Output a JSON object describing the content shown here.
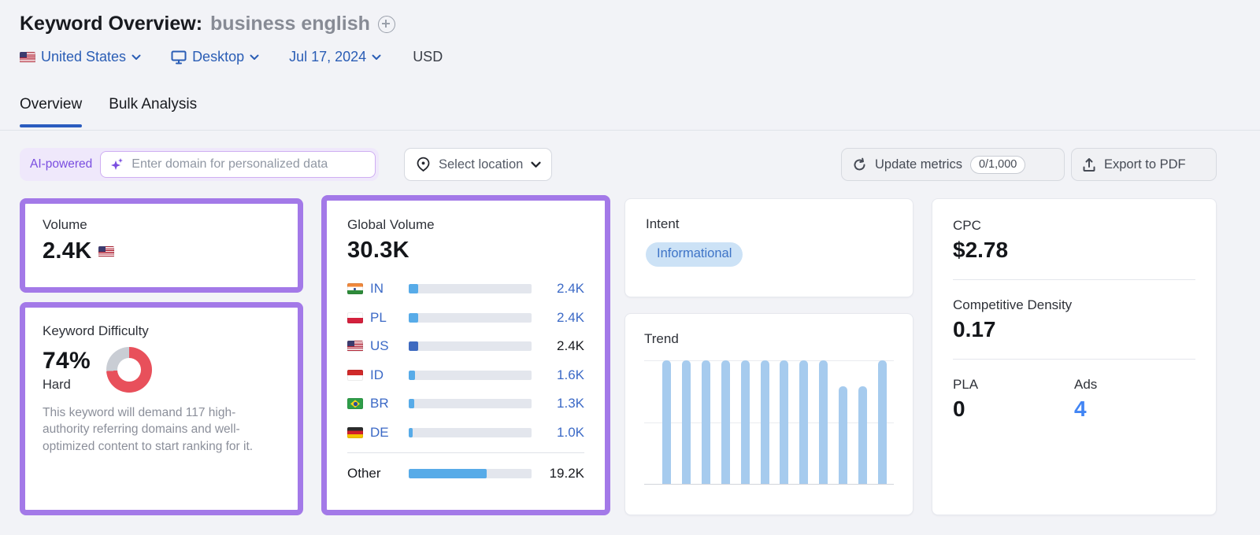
{
  "header": {
    "title": "Keyword Overview:",
    "keyword": "business english",
    "filters": {
      "country": "United States",
      "device": "Desktop",
      "date": "Jul 17, 2024",
      "currency": "USD"
    }
  },
  "tabs": [
    {
      "label": "Overview",
      "active": true
    },
    {
      "label": "Bulk Analysis",
      "active": false
    }
  ],
  "toolbar": {
    "ai_badge": "AI-powered",
    "domain_placeholder": "Enter domain for personalized data",
    "location_label": "Select location",
    "update_metrics_label": "Update metrics",
    "update_metrics_quota": "0/1,000",
    "export_label": "Export to PDF"
  },
  "cards": {
    "volume": {
      "label": "Volume",
      "value": "2.4K"
    },
    "keyword_difficulty": {
      "label": "Keyword Difficulty",
      "value": "74%",
      "severity": "Hard",
      "donut_pct": 74,
      "description": "This keyword will demand 117 high-authority referring domains and well-optimized content to start ranking for it."
    },
    "global_volume": {
      "label": "Global Volume",
      "value": "30.3K",
      "rows": [
        {
          "code": "IN",
          "value": "2.4K",
          "pct": 7.9
        },
        {
          "code": "PL",
          "value": "2.4K",
          "pct": 7.9
        },
        {
          "code": "US",
          "value": "2.4K",
          "pct": 7.9
        },
        {
          "code": "ID",
          "value": "1.6K",
          "pct": 5.3
        },
        {
          "code": "BR",
          "value": "1.3K",
          "pct": 4.3
        },
        {
          "code": "DE",
          "value": "1.0K",
          "pct": 3.3
        }
      ],
      "other": {
        "label": "Other",
        "value": "19.2K",
        "pct": 63.4
      }
    },
    "intent": {
      "label": "Intent",
      "badge": "Informational"
    },
    "trend": {
      "label": "Trend"
    },
    "cpc": {
      "label": "CPC",
      "value": "$2.78"
    },
    "competitive_density": {
      "label": "Competitive Density",
      "value": "0.17"
    },
    "pla": {
      "label": "PLA",
      "value": "0"
    },
    "ads": {
      "label": "Ads",
      "value": "4"
    }
  },
  "chart_data": [
    {
      "id": "trend",
      "type": "bar",
      "title": "Trend",
      "categories": [
        "1",
        "2",
        "3",
        "4",
        "5",
        "6",
        "7",
        "8",
        "9",
        "10",
        "11",
        "12"
      ],
      "values": [
        1,
        1,
        1,
        1,
        1,
        1,
        1,
        1,
        1,
        0.79,
        0.79,
        1
      ],
      "xlabel": "",
      "ylabel": "",
      "ylim": [
        0,
        1
      ],
      "grid": "on",
      "legend": "none",
      "bar_color": "#a6cbee"
    },
    {
      "id": "global_volume",
      "type": "bar",
      "orientation": "horizontal",
      "title": "Global Volume 30.3K",
      "categories": [
        "IN",
        "PL",
        "US",
        "ID",
        "BR",
        "DE",
        "Other"
      ],
      "values": [
        2400,
        2400,
        2400,
        1600,
        1300,
        1000,
        19200
      ],
      "value_labels": [
        "2.4K",
        "2.4K",
        "2.4K",
        "1.6K",
        "1.3K",
        "1.0K",
        "19.2K"
      ],
      "total": 30300
    },
    {
      "id": "keyword_difficulty_donut",
      "type": "pie",
      "labels": [
        "difficulty",
        "remainder"
      ],
      "values": [
        74,
        26
      ],
      "colors": [
        "#e8505b",
        "#c9cdd4"
      ]
    }
  ],
  "colors": {
    "accent_purple": "#a379e8",
    "link_blue": "#2a5db5",
    "value_blue": "#3b69c6",
    "kd_red": "#e8505b",
    "donut_gray": "#c9cdd4",
    "trend_bar": "#a6cbee",
    "intent_badge_bg": "#cce2f6",
    "ads_blue": "#4285f4"
  }
}
